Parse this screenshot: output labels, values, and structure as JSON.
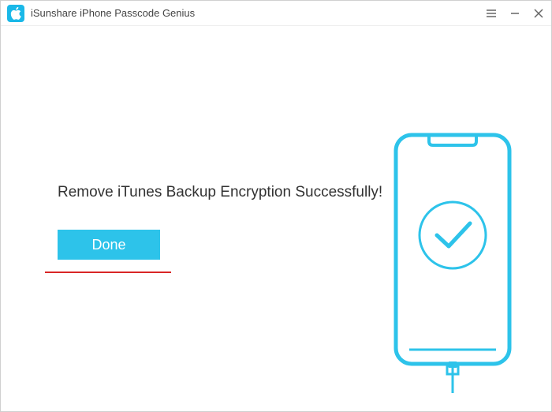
{
  "titlebar": {
    "app_name": "iSunshare iPhone Passcode Genius"
  },
  "main": {
    "message": "Remove iTunes Backup Encryption Successfully!",
    "done_label": "Done"
  },
  "colors": {
    "accent": "#2dc3ea",
    "annotation": "#d92626"
  }
}
